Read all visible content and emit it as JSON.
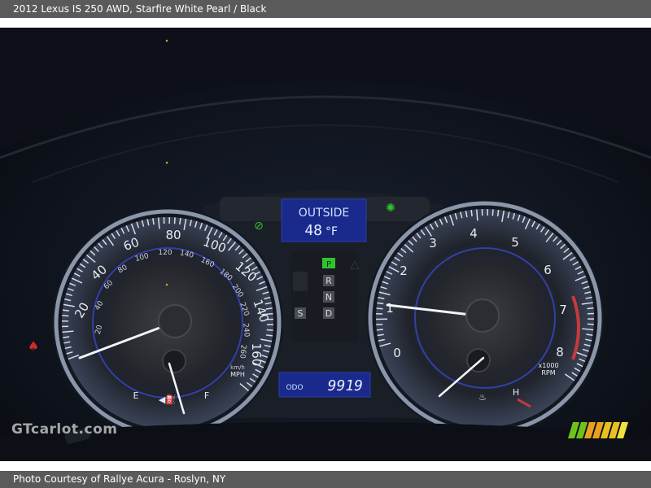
{
  "header": {
    "caption": "2012 Lexus IS 250 AWD,  Starfire White Pearl / Black"
  },
  "footer": {
    "credit": "Photo Courtesy of Rallye Acura - Roslyn, NY"
  },
  "photo": {
    "subject": "instrument cluster",
    "watermark": "GTcarlot.com",
    "display": {
      "outside_label": "OUTSIDE",
      "temperature": "48",
      "temperature_unit": "°F",
      "odo_label": "ODO",
      "odometer": "9919"
    },
    "gear_indicator": [
      "P",
      "R",
      "N",
      "D"
    ],
    "gear_mode": "S",
    "speedometer": {
      "mph_ticks": [
        "20",
        "40",
        "60",
        "80",
        "100",
        "120",
        "140",
        "160"
      ],
      "kmh_ticks": [
        "20",
        "40",
        "60",
        "80",
        "100",
        "120",
        "140",
        "160",
        "180",
        "200",
        "220",
        "240",
        "260"
      ],
      "unit_kmh": "km/h",
      "unit_mph": "MPH"
    },
    "tachometer": {
      "ticks": [
        "0",
        "1",
        "2",
        "3",
        "4",
        "5",
        "6",
        "7",
        "8"
      ],
      "unit_line1": "x1000",
      "unit_line2": "RPM"
    },
    "fuel_gauge": {
      "empty_label": "E",
      "full_label": "F"
    },
    "temp_gauge": {
      "hot_label": "H"
    },
    "colors": {
      "display_blue": "#1a2a8c",
      "display_text": "#cfe0ff",
      "gauge_ring": "#7f8ca0",
      "indicator_green": "#2fc42f",
      "redline": "#c83a3a",
      "warning_red": "#d02a2a"
    }
  }
}
